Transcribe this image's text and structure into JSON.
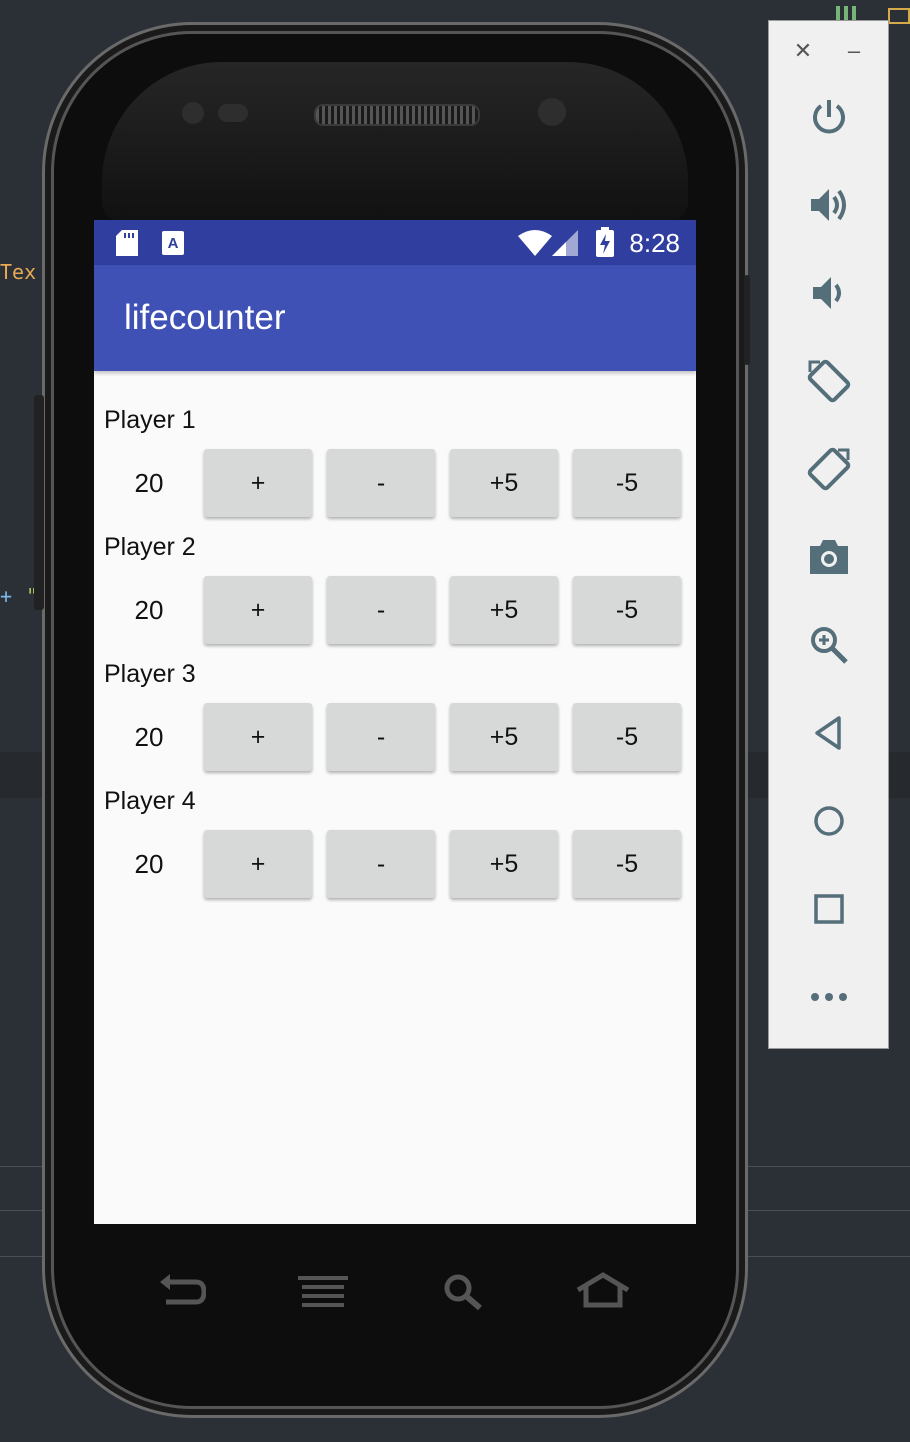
{
  "ide": {
    "fragment_text": "Tex",
    "fragment_plus": "+",
    "fragment_quote": "\""
  },
  "status_bar": {
    "time": "8:28",
    "icons": [
      "sd-card-icon",
      "a-notification-icon",
      "wifi-icon",
      "signal-icon",
      "battery-charging-icon"
    ]
  },
  "app": {
    "title": "lifecounter"
  },
  "players": [
    {
      "label": "Player 1",
      "life": "20",
      "buttons": [
        "+",
        "-",
        "+5",
        "-5"
      ]
    },
    {
      "label": "Player 2",
      "life": "20",
      "buttons": [
        "+",
        "-",
        "+5",
        "-5"
      ]
    },
    {
      "label": "Player 3",
      "life": "20",
      "buttons": [
        "+",
        "-",
        "+5",
        "-5"
      ]
    },
    {
      "label": "Player 4",
      "life": "20",
      "buttons": [
        "+",
        "-",
        "+5",
        "-5"
      ]
    }
  ],
  "phone_nav": [
    "back-icon",
    "menu-icon",
    "search-icon",
    "home-icon"
  ],
  "emulator_panel": {
    "controls": [
      "close-icon",
      "minimize-icon"
    ],
    "buttons": [
      "power-icon",
      "volume-up-icon",
      "volume-down-icon",
      "rotate-left-icon",
      "rotate-right-icon",
      "camera-icon",
      "zoom-icon",
      "back-triangle-icon",
      "home-circle-icon",
      "overview-square-icon",
      "more-icon"
    ]
  },
  "colors": {
    "status_bar": "#303f9f",
    "app_bar": "#3f51b5",
    "button": "#d7d8d8",
    "screen_bg": "#fafafa",
    "panel_icon": "#546e7a"
  }
}
